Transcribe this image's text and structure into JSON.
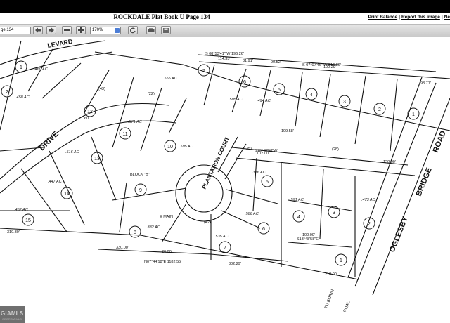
{
  "window": {
    "title": "ROCKDALE Plat Book U Page 134",
    "links": [
      "Print Balance",
      "Report this image",
      "Ne"
    ]
  },
  "toolbar": {
    "page_field_value": "ge 134",
    "zoom_value": "170%",
    "buttons": [
      "back-arrow-icon",
      "forward-arrow-icon",
      "zoom-out-icon",
      "zoom-in-icon",
      "rotate-icon",
      "print-icon",
      "save-icon"
    ]
  },
  "plat": {
    "streets": [
      "DRIVE",
      "BOULEVARD",
      "PLANTATION COURT",
      "OGLESBY BRIDGE ROAD"
    ],
    "street_labels": {
      "drive": "DRIVE",
      "blvd": "LEVARD",
      "court": "PLANTATION COURT",
      "bridge": "BRIDGE",
      "road": "ROAD",
      "oglesby": "OGLESBY"
    },
    "bearings": [
      "S 08°53'41\" W 196.26'",
      "S 07°07'46\" W 516.80'",
      "S13°48'58\"W",
      "N07°44'18\"E 1182.55'",
      "S13°48'58\"E"
    ],
    "lot_numbers": [
      "1",
      "2",
      "3",
      "4",
      "5",
      "6",
      "7",
      "8",
      "9",
      "10",
      "11",
      "12",
      "13",
      "14",
      "15"
    ],
    "block": "BLOCK \"B\"",
    "emain": "E MAIN",
    "dims": [
      "310.30'",
      "330.00'",
      "302.29'",
      "210.00'",
      "100.00'",
      "102.00'",
      "20.00'",
      "109.58'",
      "114.35'",
      "81.91'",
      "90.52'",
      "100.29'",
      "93.77'",
      "120.00'"
    ],
    "areas": [
      ".460 AC",
      ".458 AC",
      ".571 AC",
      ".595 AC",
      ".382 AC",
      ".516 AC",
      ".447 AC",
      ".452 AC",
      ".386 AC",
      ".535 AC",
      ".473 AC",
      ".591 AC",
      ".586 AC",
      ".505 AC",
      ".494 AC",
      ".555 AC"
    ],
    "misc": [
      "EASEMENT",
      "(42)",
      "(35)",
      "(22)",
      "(28)",
      "(43)",
      "60'",
      "TO BORIN",
      "ROAD"
    ]
  },
  "watermark": {
    "text": "GIAMLS",
    "sub": "GEORGIA MLS"
  }
}
